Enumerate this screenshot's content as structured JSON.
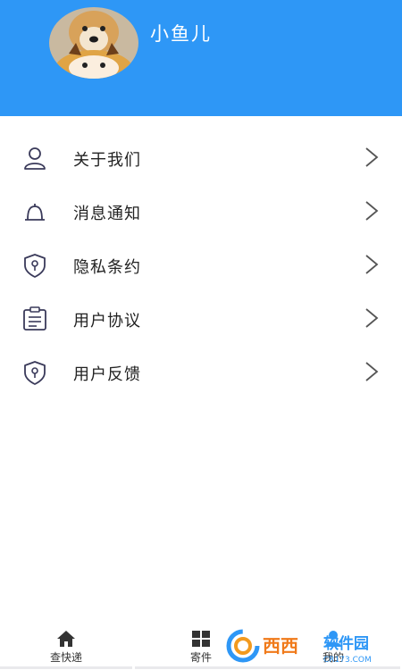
{
  "profile": {
    "username": "小鱼儿"
  },
  "menu": {
    "items": [
      {
        "label": "关于我们",
        "icon": "user-icon"
      },
      {
        "label": "消息通知",
        "icon": "bell-icon"
      },
      {
        "label": "隐私条约",
        "icon": "shield-icon"
      },
      {
        "label": "用户协议",
        "icon": "clipboard-icon"
      },
      {
        "label": "用户反馈",
        "icon": "shield-icon"
      }
    ]
  },
  "tabbar": {
    "tabs": [
      {
        "label": "查快递",
        "icon": "home-icon"
      },
      {
        "label": "寄件",
        "icon": "grid-icon"
      },
      {
        "label": "我的",
        "icon": "user-icon"
      }
    ]
  },
  "watermark": {
    "text": "西西软件园",
    "domain": "CR173.COM"
  },
  "colors": {
    "header": "#2e97f6",
    "icon": "#3a3a5a",
    "chevron": "#555555"
  }
}
